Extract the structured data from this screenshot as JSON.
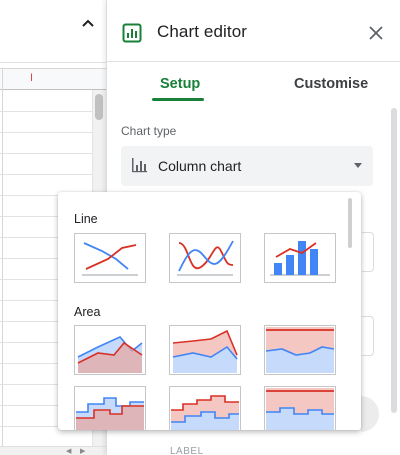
{
  "editor": {
    "title": "Chart editor",
    "tabs": [
      {
        "label": "Setup",
        "active": true
      },
      {
        "label": "Customise",
        "active": false
      }
    ],
    "chart_type_label": "Chart type",
    "chart_type_value": "Column chart",
    "hidden_section_label": "LABEL"
  },
  "dropdown": {
    "groups": [
      {
        "label": "Line",
        "options": [
          "line-chart-icon",
          "smooth-line-chart-icon",
          "combo-chart-icon"
        ]
      },
      {
        "label": "Area",
        "options": [
          "area-chart-icon",
          "stacked-area-chart-icon",
          "100-percent-stacked-area-chart-icon",
          "stepped-area-chart-icon",
          "stacked-stepped-area-chart-icon",
          "100-percent-stacked-stepped-area-chart-icon"
        ]
      }
    ]
  },
  "colors": {
    "accent": "#188038",
    "series_red": "#d93025",
    "series_blue": "#4285f4",
    "fill_red": "#f4c7c3",
    "fill_blue": "#c6dafc"
  }
}
